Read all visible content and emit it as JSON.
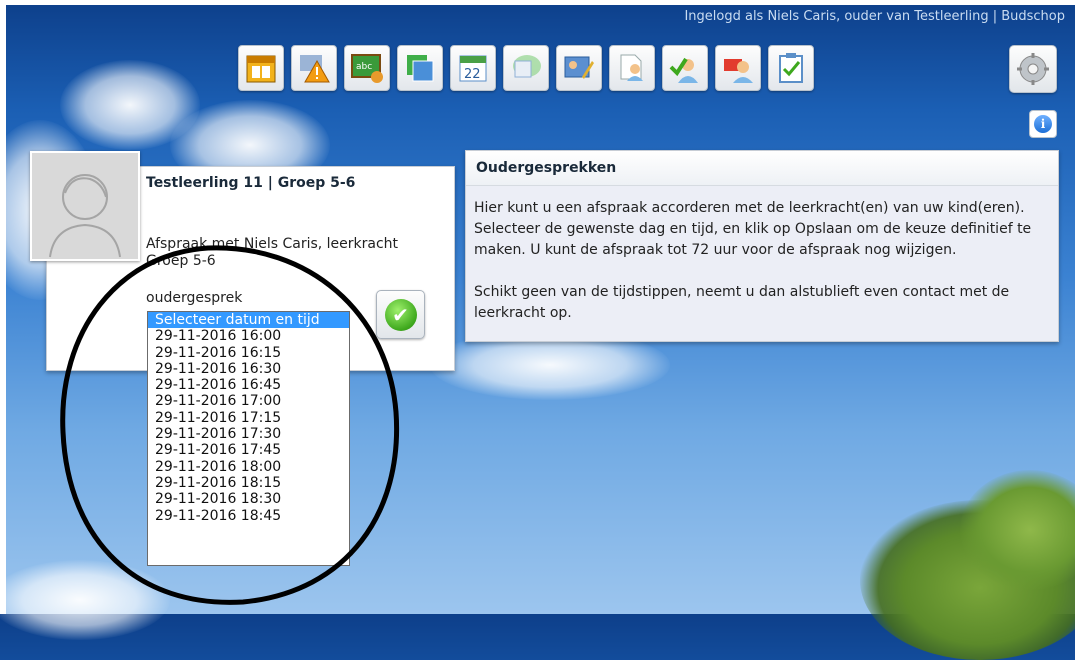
{
  "header": {
    "login_text": "Ingelogd als Niels Caris, ouder van Testleerling | Budschop"
  },
  "toolbar": {
    "icons": [
      "calendar-icon",
      "warning-icon",
      "blackboard-icon",
      "windows-icon",
      "date-icon",
      "chat-icon",
      "id-card-icon",
      "person-edit-icon",
      "person-check-icon",
      "person-card-icon",
      "clipboard-check-icon"
    ],
    "settings_icon": "gear-icon",
    "info_icon": "info-icon",
    "info_label": "i"
  },
  "student": {
    "title": "Testleerling 11 | Groep 5-6",
    "appointment": "Afspraak met Niels Caris, leerkracht Groep 5-6",
    "type": "oudergesprek",
    "confirm_icon": "checkmark-icon",
    "confirm_symbol": "✔"
  },
  "datetime_select": {
    "options": [
      "Selecteer datum en tijd",
      "29-11-2016 16:00",
      "29-11-2016 16:15",
      "29-11-2016 16:30",
      "29-11-2016 16:45",
      "29-11-2016 17:00",
      "29-11-2016 17:15",
      "29-11-2016 17:30",
      "29-11-2016 17:45",
      "29-11-2016 18:00",
      "29-11-2016 18:15",
      "29-11-2016 18:30",
      "29-11-2016 18:45"
    ],
    "selected_index": 0
  },
  "info_panel": {
    "title": "Oudergesprekken",
    "paragraph1": "Hier kunt u een afspraak accorderen met de leerkracht(en) van uw kind(eren). Selecteer de gewenste dag en tijd, en klik op Opslaan om de keuze definitief te maken. U kunt de afspraak tot 72 uur voor de afspraak nog wijzigen.",
    "paragraph2": "Schikt geen van de tijdstippen, neemt u dan alstublieft even contact met de leerkracht op."
  },
  "colors": {
    "selection": "#3399ff",
    "annotation": "#000000"
  }
}
